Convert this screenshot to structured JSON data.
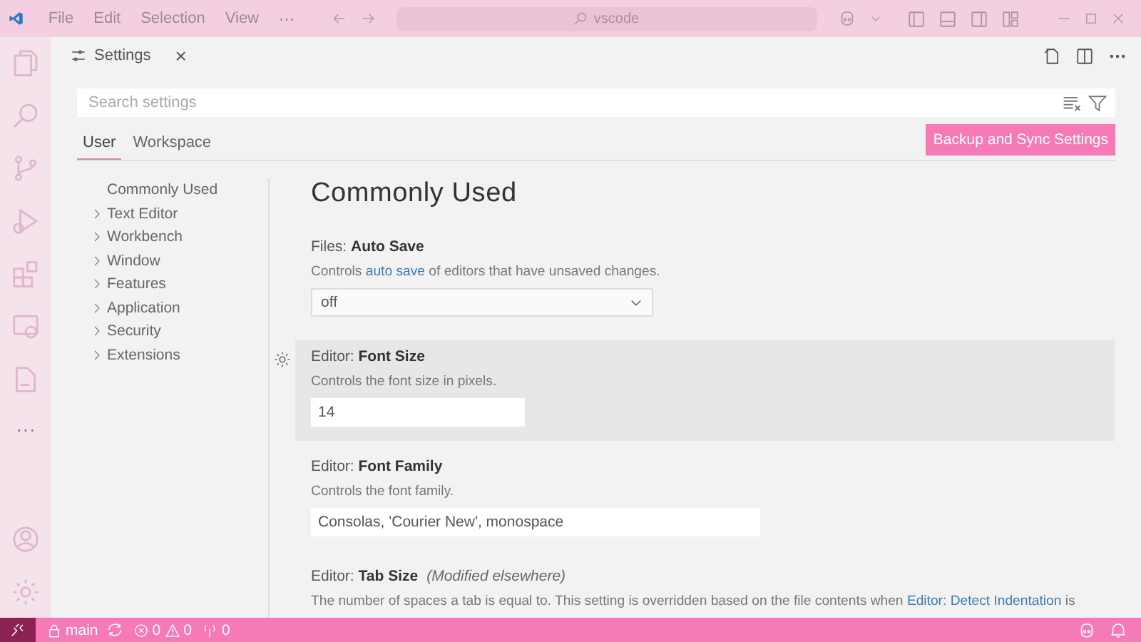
{
  "title_bar": {
    "menu": [
      "File",
      "Edit",
      "Selection",
      "View",
      "⋯"
    ],
    "command_center": "vscode"
  },
  "editor_tab": {
    "title": "Settings",
    "close": "×"
  },
  "search": {
    "placeholder": "Search settings"
  },
  "scopes": [
    {
      "label": "User",
      "selected": true
    },
    {
      "label": "Workspace",
      "selected": false
    }
  ],
  "sync_button": "Backup and Sync Settings",
  "toc": [
    {
      "label": "Commonly Used",
      "expandable": false
    },
    {
      "label": "Text Editor",
      "expandable": true
    },
    {
      "label": "Workbench",
      "expandable": true
    },
    {
      "label": "Window",
      "expandable": true
    },
    {
      "label": "Features",
      "expandable": true
    },
    {
      "label": "Application",
      "expandable": true
    },
    {
      "label": "Security",
      "expandable": true
    },
    {
      "label": "Extensions",
      "expandable": true
    }
  ],
  "section_title": "Commonly Used",
  "settings": [
    {
      "category": "Files: ",
      "name": "Auto Save",
      "focused": false,
      "kind": "select",
      "value": "off",
      "description": [
        {
          "text": "Controls ",
          "link": false
        },
        {
          "text": "auto save",
          "link": true
        },
        {
          "text": " of editors that have unsaved changes.",
          "link": false
        }
      ]
    },
    {
      "category": "Editor: ",
      "name": "Font Size",
      "focused": true,
      "kind": "number",
      "value": "14",
      "description": [
        {
          "text": "Controls the font size in pixels.",
          "link": false
        }
      ]
    },
    {
      "category": "Editor: ",
      "name": "Font Family",
      "focused": false,
      "kind": "text",
      "value": "Consolas, 'Courier New', monospace",
      "description": [
        {
          "text": "Controls the font family.",
          "link": false
        }
      ]
    },
    {
      "category": "Editor: ",
      "name": "Tab Size",
      "modified": "(Modified elsewhere)",
      "focused": false,
      "kind": "number",
      "description": [
        {
          "text": "The number of spaces a tab is equal to. This setting is overridden based on the file contents when ",
          "link": false
        },
        {
          "text": "Editor: Detect Indentation",
          "link": true
        },
        {
          "text": " is",
          "link": false
        }
      ]
    }
  ],
  "status_bar": {
    "branch": "main",
    "errors": "0",
    "warnings": "0",
    "ports": "0"
  }
}
